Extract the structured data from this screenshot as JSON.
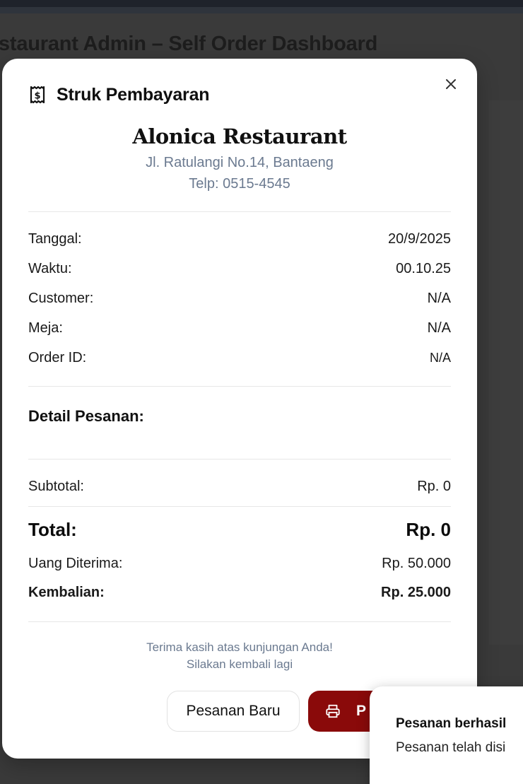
{
  "page": {
    "title": "estaurant Admin – Self Order Dashboard"
  },
  "modal": {
    "title": "Struk Pembayaran",
    "icon": "receipt-icon",
    "close_icon": "close-icon",
    "restaurant": {
      "name": "Alonica Restaurant",
      "address": "Jl. Ratulangi No.14, Bantaeng",
      "phone": "Telp: 0515-4545"
    },
    "info": [
      {
        "label": "Tanggal:",
        "value": "20/9/2025"
      },
      {
        "label": "Waktu:",
        "value": "00.10.25"
      },
      {
        "label": "Customer:",
        "value": "N/A"
      },
      {
        "label": "Meja:",
        "value": "N/A"
      },
      {
        "label": "Order ID:",
        "value": "N/A"
      }
    ],
    "details_title": "Detail Pesanan:",
    "subtotal": {
      "label": "Subtotal:",
      "value": "Rp. 0"
    },
    "total": {
      "label": "Total:",
      "value": "Rp. 0"
    },
    "received": {
      "label": "Uang Diterima:",
      "value": "Rp. 50.000"
    },
    "change": {
      "label": "Kembalian:",
      "value": "Rp. 25.000"
    },
    "thanks_line1": "Terima kasih atas kunjungan Anda!",
    "thanks_line2": "Silakan kembali lagi",
    "buttons": {
      "new_order": "Pesanan Baru",
      "print": "P",
      "print_icon": "printer-icon"
    }
  },
  "toast": {
    "title": "Pesanan berhasil",
    "message": "Pesanan telah disi"
  },
  "colors": {
    "accent": "#8a0a0a",
    "muted_text": "#6b7a90",
    "overlay": "#3a3a3a"
  }
}
